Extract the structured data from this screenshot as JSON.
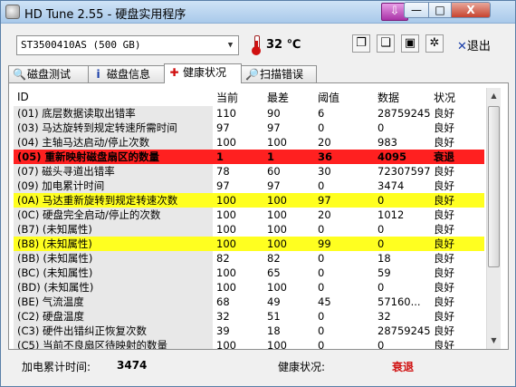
{
  "window": {
    "title": "HD Tune 2.55 - 硬盘实用程序",
    "min": "—",
    "max": "□",
    "close": "X",
    "download": "⇩"
  },
  "toolbar": {
    "drive": "ST3500410AS (500 GB)",
    "temperature": "32 ℃",
    "exit_label": "退出",
    "icons": [
      "copy-icon",
      "copy-all-icon",
      "save-icon",
      "options-icon"
    ]
  },
  "tabs": [
    {
      "label": "磁盘测试",
      "icon": "benchmark-icon"
    },
    {
      "label": "磁盘信息",
      "icon": "info-icon"
    },
    {
      "label": "健康状况",
      "icon": "health-icon",
      "active": true
    },
    {
      "label": "扫描错误",
      "icon": "scan-icon"
    }
  ],
  "table": {
    "headers": [
      "ID",
      "当前",
      "最差",
      "阈值",
      "数据",
      "状况"
    ],
    "rows": [
      {
        "id": "(01) 底层数据读取出错率",
        "cur": "110",
        "worst": "90",
        "thr": "6",
        "data": "28759245",
        "status": "良好",
        "hl": ""
      },
      {
        "id": "(03) 马达旋转到规定转速所需时间",
        "cur": "97",
        "worst": "97",
        "thr": "0",
        "data": "0",
        "status": "良好",
        "hl": ""
      },
      {
        "id": "(04) 主轴马达启动/停止次数",
        "cur": "100",
        "worst": "100",
        "thr": "20",
        "data": "983",
        "status": "良好",
        "hl": ""
      },
      {
        "id": "(05) 重新映射磁盘扇区的数量",
        "cur": "1",
        "worst": "1",
        "thr": "36",
        "data": "4095",
        "status": "衰退",
        "hl": "red"
      },
      {
        "id": "(07) 磁头寻道出错率",
        "cur": "78",
        "worst": "60",
        "thr": "30",
        "data": "72307597",
        "status": "良好",
        "hl": ""
      },
      {
        "id": "(09) 加电累计时间",
        "cur": "97",
        "worst": "97",
        "thr": "0",
        "data": "3474",
        "status": "良好",
        "hl": ""
      },
      {
        "id": "(0A) 马达重新旋转到规定转速次数",
        "cur": "100",
        "worst": "100",
        "thr": "97",
        "data": "0",
        "status": "良好",
        "hl": "yellow"
      },
      {
        "id": "(0C) 硬盘完全启动/停止的次数",
        "cur": "100",
        "worst": "100",
        "thr": "20",
        "data": "1012",
        "status": "良好",
        "hl": ""
      },
      {
        "id": "(B7) (未知属性)",
        "cur": "100",
        "worst": "100",
        "thr": "0",
        "data": "0",
        "status": "良好",
        "hl": ""
      },
      {
        "id": "(B8) (未知属性)",
        "cur": "100",
        "worst": "100",
        "thr": "99",
        "data": "0",
        "status": "良好",
        "hl": "yellow"
      },
      {
        "id": "(BB) (未知属性)",
        "cur": "82",
        "worst": "82",
        "thr": "0",
        "data": "18",
        "status": "良好",
        "hl": ""
      },
      {
        "id": "(BC) (未知属性)",
        "cur": "100",
        "worst": "65",
        "thr": "0",
        "data": "59",
        "status": "良好",
        "hl": ""
      },
      {
        "id": "(BD) (未知属性)",
        "cur": "100",
        "worst": "100",
        "thr": "0",
        "data": "0",
        "status": "良好",
        "hl": ""
      },
      {
        "id": "(BE) 气流温度",
        "cur": "68",
        "worst": "49",
        "thr": "45",
        "data": "57160...",
        "status": "良好",
        "hl": ""
      },
      {
        "id": "(C2) 硬盘温度",
        "cur": "32",
        "worst": "51",
        "thr": "0",
        "data": "32",
        "status": "良好",
        "hl": ""
      },
      {
        "id": "(C3) 硬件出错纠正恢复次数",
        "cur": "39",
        "worst": "18",
        "thr": "0",
        "data": "28759245",
        "status": "良好",
        "hl": ""
      },
      {
        "id": "(C5) 当前不良扇区待映射的数量",
        "cur": "100",
        "worst": "100",
        "thr": "0",
        "data": "0",
        "status": "良好",
        "hl": ""
      }
    ]
  },
  "status": {
    "poweron_label": "加电累计时间:",
    "poweron_value": "3474",
    "health_label": "健康状况:",
    "health_value": "衰退"
  },
  "colors": {
    "critical": "#ff2020",
    "warning": "#ffff20",
    "degraded_text": "#d01010"
  }
}
